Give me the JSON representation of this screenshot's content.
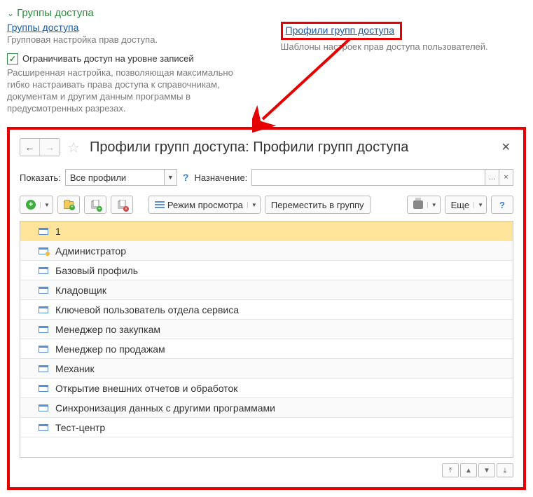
{
  "section": {
    "title": "Группы доступа",
    "left_link": "Группы доступа",
    "left_desc": "Групповая настройка прав доступа.",
    "right_link": "Профили групп доступа",
    "right_desc": "Шаблоны настроек прав доступа пользователей.",
    "checkbox_label": "Ограничивать доступ на уровне записей",
    "extended_desc": "Расширенная настройка, позволяющая максимально гибко настраивать права доступа к справочникам, документам и другим данным программы в предусмотренных разрезах."
  },
  "window": {
    "title": "Профили групп доступа: Профили групп доступа",
    "show_label": "Показать:",
    "show_value": "Все профили",
    "purpose_label": "Назначение:",
    "purpose_value": "",
    "purpose_dots": "...",
    "purpose_clear": "×",
    "view_mode": "Режим просмотра",
    "move_to_group": "Переместить в группу",
    "more": "Еще",
    "help": "?"
  },
  "rows": [
    {
      "label": "1",
      "selected": true,
      "adm": false
    },
    {
      "label": "Администратор",
      "adm": true
    },
    {
      "label": "Базовый профиль",
      "adm": false
    },
    {
      "label": "Кладовщик",
      "adm": false
    },
    {
      "label": "Ключевой пользователь отдела сервиса",
      "adm": false
    },
    {
      "label": "Менеджер по закупкам",
      "adm": false
    },
    {
      "label": "Менеджер по продажам",
      "adm": false
    },
    {
      "label": "Механик",
      "adm": false
    },
    {
      "label": "Открытие внешних отчетов и обработок",
      "adm": false
    },
    {
      "label": "Синхронизация данных с другими программами",
      "adm": false
    },
    {
      "label": "Тест-центр",
      "adm": false
    }
  ]
}
